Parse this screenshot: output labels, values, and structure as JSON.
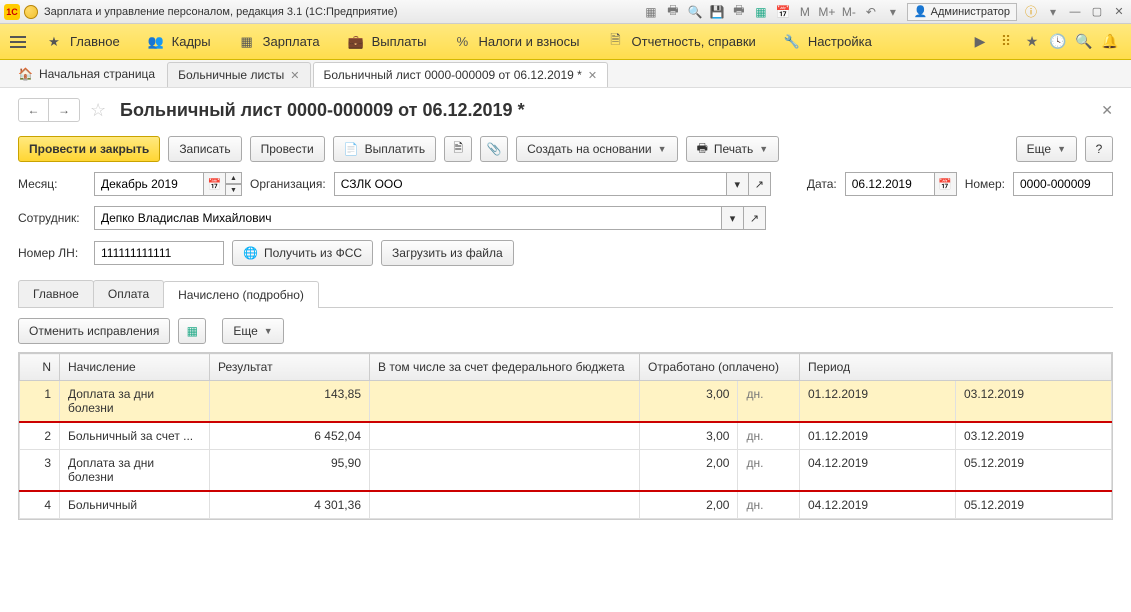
{
  "titlebar": {
    "title": "Зарплата и управление персоналом, редакция 3.1  (1С:Предприятие)",
    "user": "Администратор",
    "m": "M",
    "mplus": "M+",
    "mminus": "M-"
  },
  "mainmenu": {
    "items": [
      {
        "label": "Главное"
      },
      {
        "label": "Кадры"
      },
      {
        "label": "Зарплата"
      },
      {
        "label": "Выплаты"
      },
      {
        "label": "Налоги и взносы"
      },
      {
        "label": "Отчетность, справки"
      },
      {
        "label": "Настройка"
      }
    ]
  },
  "opentabs": {
    "home": "Начальная страница",
    "tabs": [
      {
        "label": "Больничные листы"
      },
      {
        "label": "Больничный лист 0000-000009 от 06.12.2019 *",
        "active": true
      }
    ]
  },
  "page": {
    "title": "Больничный лист 0000-000009 от 06.12.2019 *"
  },
  "toolbar": {
    "post_close": "Провести и закрыть",
    "save": "Записать",
    "post": "Провести",
    "pay": "Выплатить",
    "create_basis": "Создать на основании",
    "print": "Печать",
    "more": "Еще",
    "help": "?"
  },
  "form": {
    "month_lbl": "Месяц:",
    "month_val": "Декабрь 2019",
    "org_lbl": "Организация:",
    "org_val": "СЗЛК ООО",
    "date_lbl": "Дата:",
    "date_val": "06.12.2019",
    "number_lbl": "Номер:",
    "number_val": "0000-000009",
    "employee_lbl": "Сотрудник:",
    "employee_val": "Депко Владислав Михайлович",
    "ln_lbl": "Номер ЛН:",
    "ln_val": "111111111111",
    "get_fss": "Получить из ФСС",
    "load_file": "Загрузить из файла"
  },
  "innertabs": {
    "main": "Главное",
    "payment": "Оплата",
    "accrued": "Начислено (подробно)"
  },
  "gridbar": {
    "cancel_fix": "Отменить исправления",
    "more": "Еще"
  },
  "grid": {
    "cols": {
      "n": "N",
      "accrual": "Начисление",
      "result": "Результат",
      "federal": "В том числе за счет федерального бюджета",
      "worked": "Отработано (оплачено)",
      "period": "Период"
    },
    "rows": [
      {
        "n": "1",
        "accrual": "Доплата за дни болезни",
        "result": "143,85",
        "federal": "",
        "worked": "3,00",
        "unit": "дн.",
        "p1": "01.12.2019",
        "p2": "03.12.2019",
        "hl": true,
        "redline": true
      },
      {
        "n": "2",
        "accrual": "Больничный за счет ...",
        "result": "6 452,04",
        "federal": "",
        "worked": "3,00",
        "unit": "дн.",
        "p1": "01.12.2019",
        "p2": "03.12.2019"
      },
      {
        "n": "3",
        "accrual": "Доплата за дни болезни",
        "result": "95,90",
        "federal": "",
        "worked": "2,00",
        "unit": "дн.",
        "p1": "04.12.2019",
        "p2": "05.12.2019",
        "redline": true
      },
      {
        "n": "4",
        "accrual": "Больничный",
        "result": "4 301,36",
        "federal": "",
        "worked": "2,00",
        "unit": "дн.",
        "p1": "04.12.2019",
        "p2": "05.12.2019"
      }
    ]
  }
}
